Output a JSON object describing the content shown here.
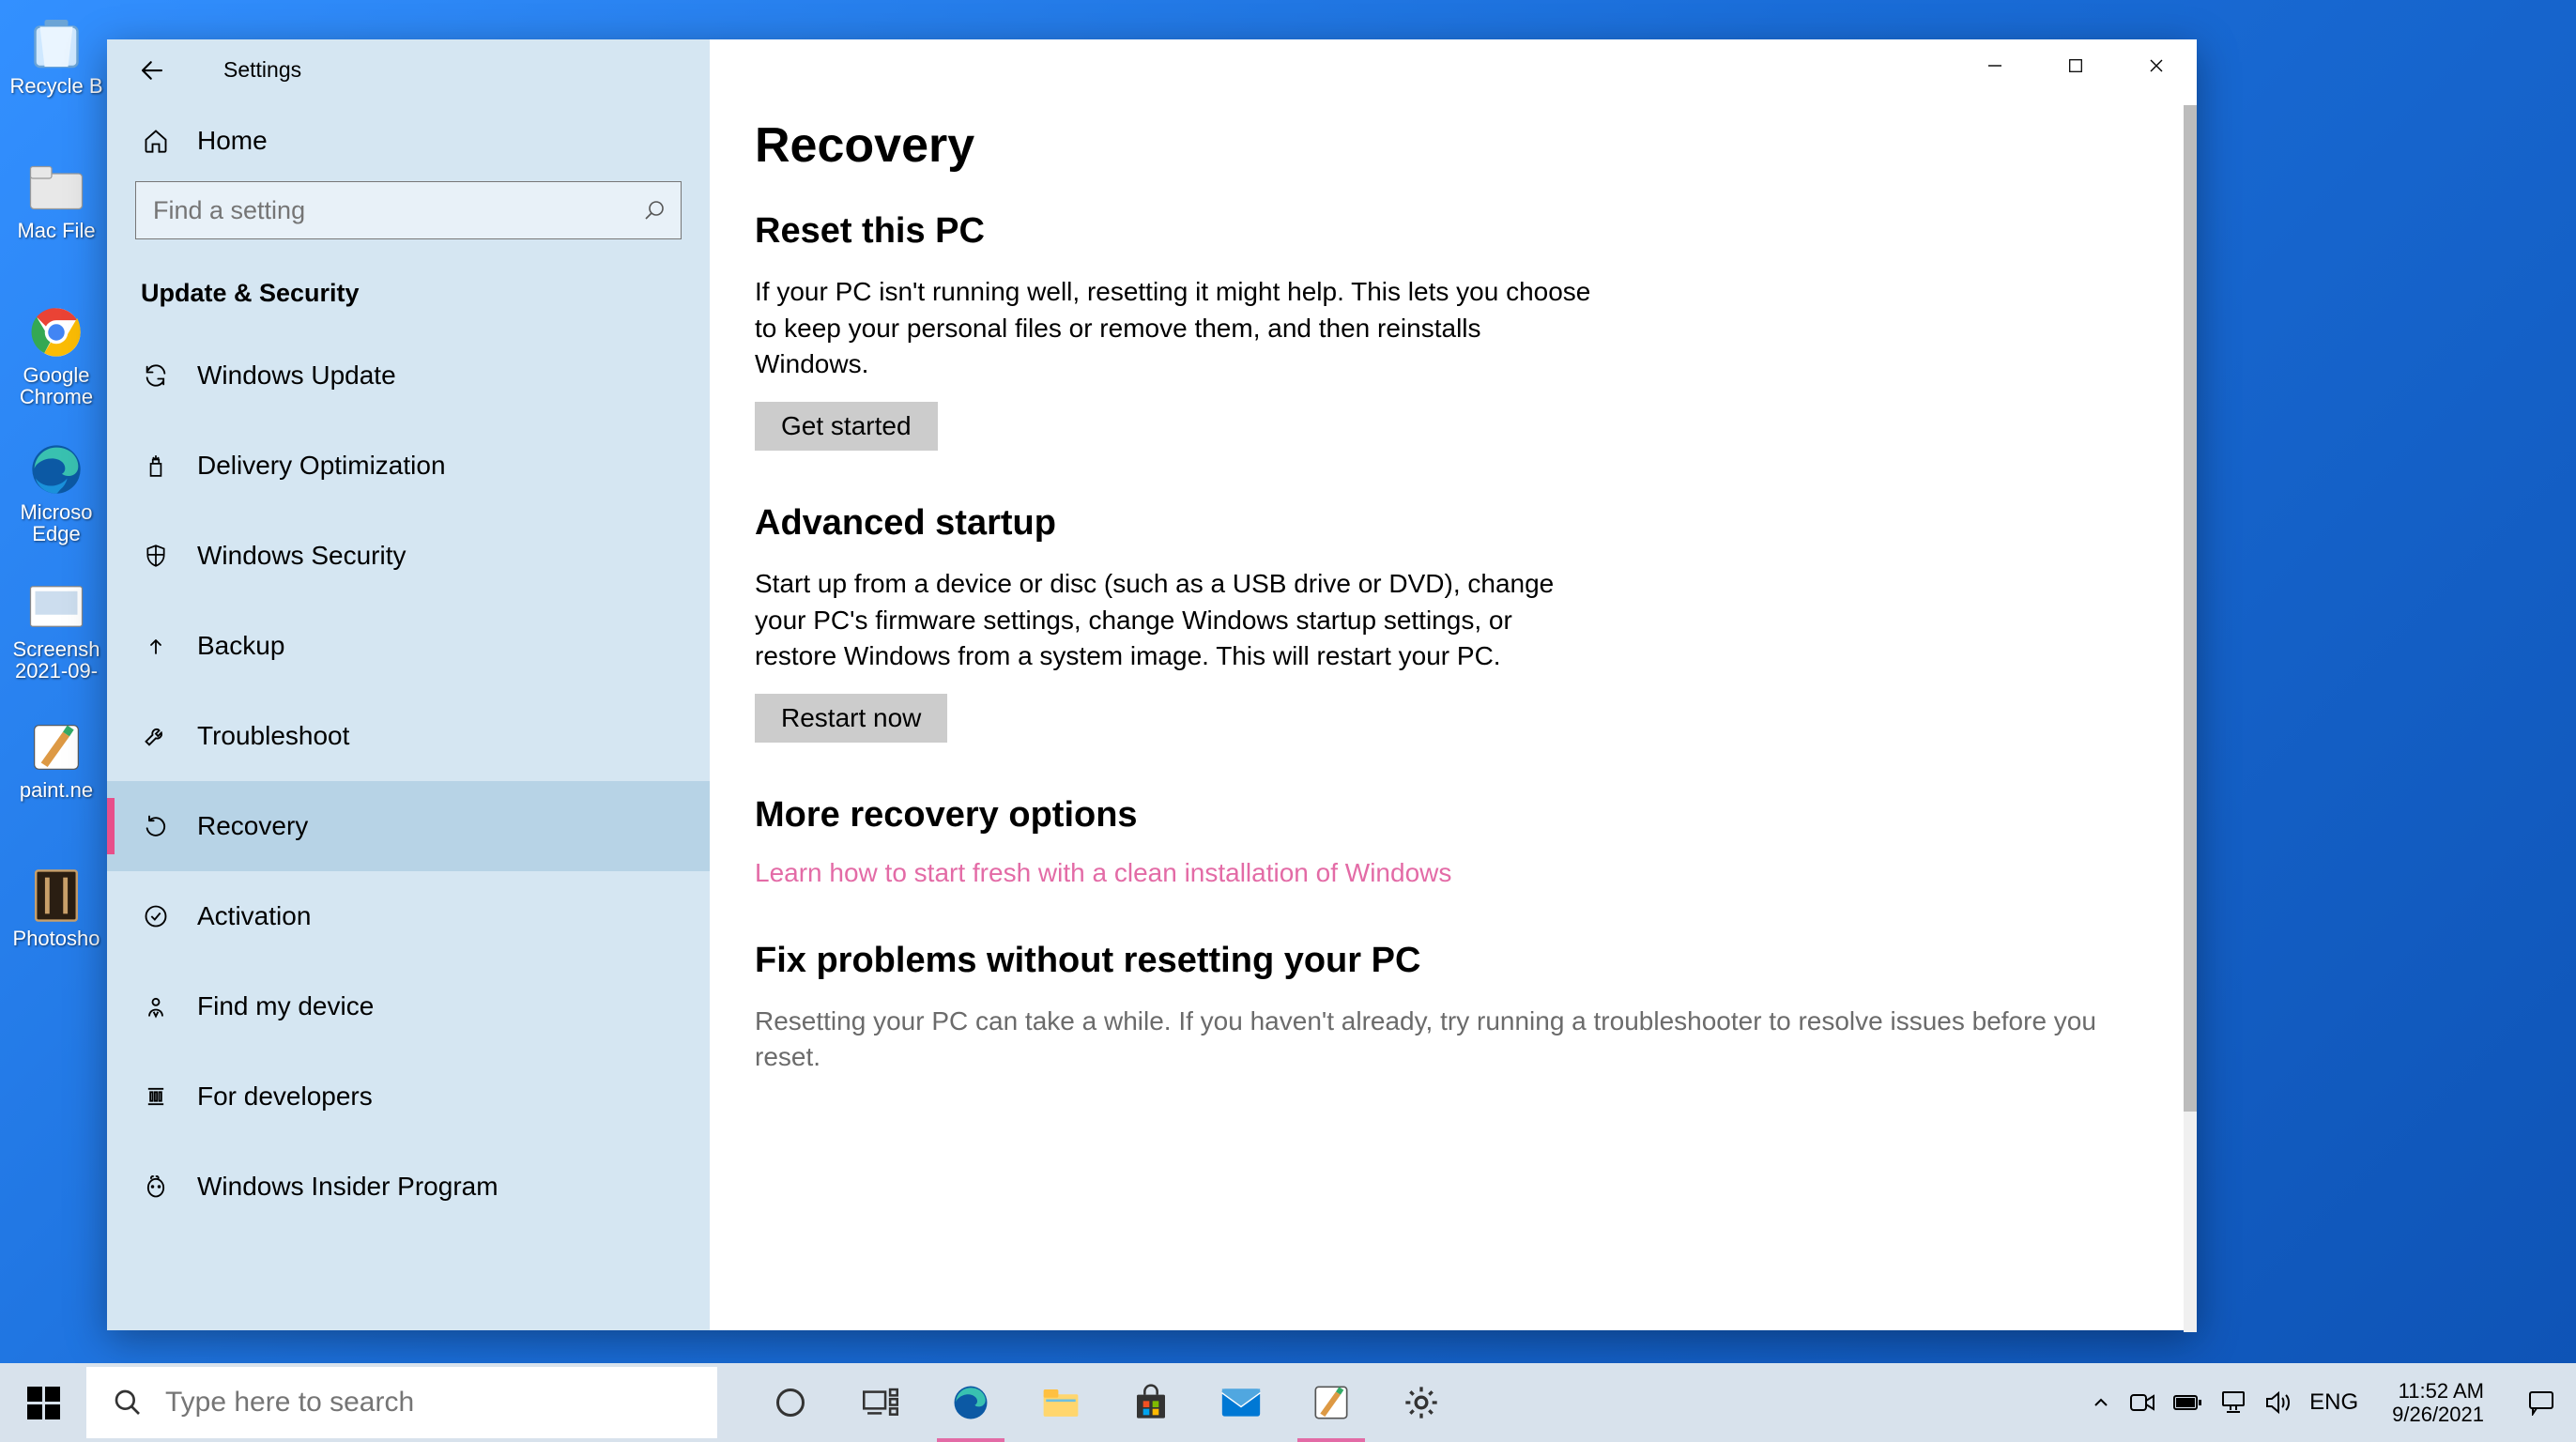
{
  "desktop_icons": [
    {
      "name": "recycle-bin",
      "label": "Recycle B"
    },
    {
      "name": "mac-files",
      "label": "Mac File"
    },
    {
      "name": "google-chrome",
      "label": "Google\nChrome"
    },
    {
      "name": "microsoft-edge",
      "label": "Microso\nEdge"
    },
    {
      "name": "screenshot-folder",
      "label": "Screensh\n2021-09-"
    },
    {
      "name": "paint-net",
      "label": "paint.ne"
    },
    {
      "name": "photoshop",
      "label": "Photosho"
    }
  ],
  "window": {
    "app_title": "Settings",
    "home_label": "Home",
    "search_placeholder": "Find a setting",
    "category": "Update & Security",
    "nav": [
      {
        "key": "windows-update",
        "label": "Windows Update"
      },
      {
        "key": "delivery-optimization",
        "label": "Delivery Optimization"
      },
      {
        "key": "windows-security",
        "label": "Windows Security"
      },
      {
        "key": "backup",
        "label": "Backup"
      },
      {
        "key": "troubleshoot",
        "label": "Troubleshoot"
      },
      {
        "key": "recovery",
        "label": "Recovery",
        "selected": true
      },
      {
        "key": "activation",
        "label": "Activation"
      },
      {
        "key": "find-my-device",
        "label": "Find my device"
      },
      {
        "key": "for-developers",
        "label": "For developers"
      },
      {
        "key": "windows-insider",
        "label": "Windows Insider Program"
      }
    ]
  },
  "content": {
    "page_title": "Recovery",
    "sections": {
      "reset": {
        "heading": "Reset this PC",
        "body": "If your PC isn't running well, resetting it might help. This lets you choose to keep your personal files or remove them, and then reinstalls Windows.",
        "button": "Get started"
      },
      "advanced": {
        "heading": "Advanced startup",
        "body": "Start up from a device or disc (such as a USB drive or DVD), change your PC's firmware settings, change Windows startup settings, or restore Windows from a system image. This will restart your PC.",
        "button": "Restart now"
      },
      "more": {
        "heading": "More recovery options",
        "link": "Learn how to start fresh with a clean installation of Windows"
      },
      "fix": {
        "heading": "Fix problems without resetting your PC",
        "body": "Resetting your PC can take a while. If you haven't already, try running a troubleshooter to resolve issues before you reset."
      }
    }
  },
  "taskbar": {
    "search_placeholder": "Type here to search",
    "language": "ENG",
    "time": "11:52 AM",
    "date": "9/26/2021"
  }
}
